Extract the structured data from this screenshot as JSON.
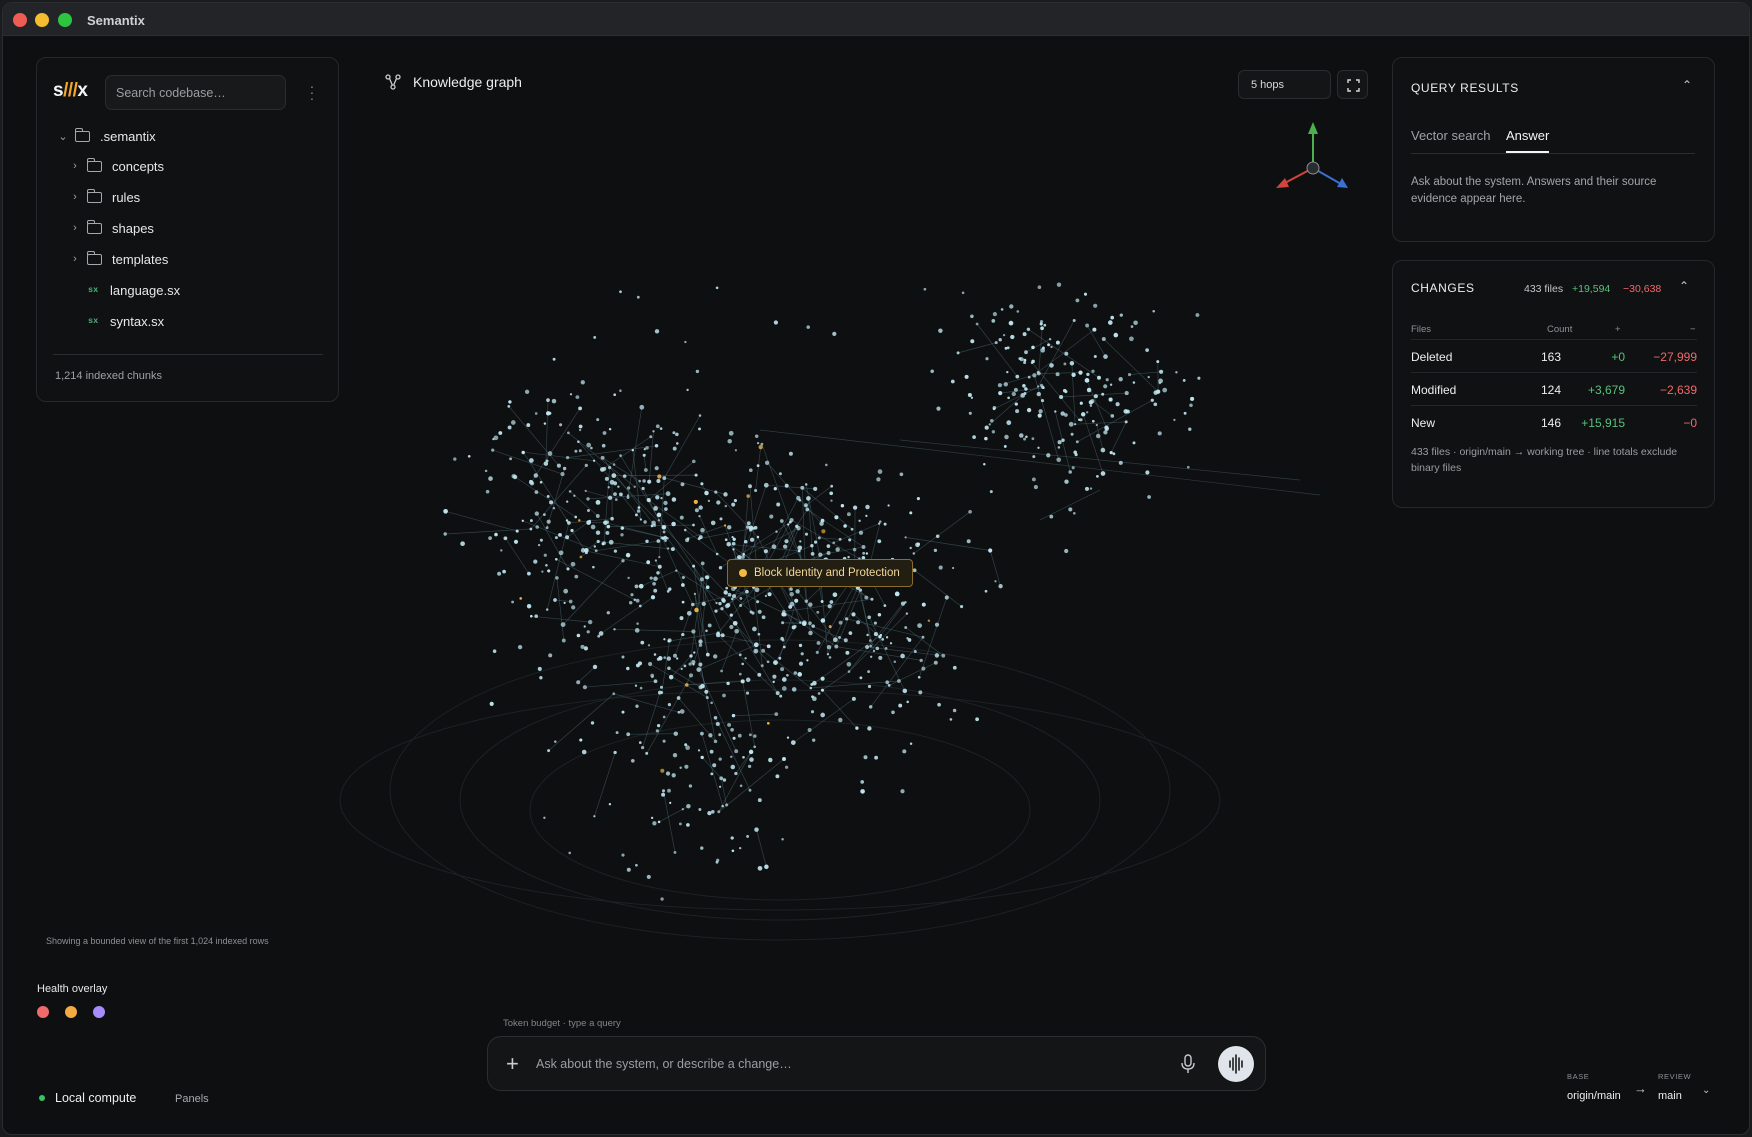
{
  "app": {
    "title": "Semantix"
  },
  "explorer": {
    "logo": {
      "a": "s",
      "b": "///",
      "c": "x"
    },
    "search_placeholder": "Search codebase…",
    "tree": [
      {
        "label": ".semantix",
        "type": "folder",
        "expanded": true,
        "depth": 0
      },
      {
        "label": "concepts",
        "type": "folder",
        "expanded": false,
        "depth": 1
      },
      {
        "label": "rules",
        "type": "folder",
        "expanded": false,
        "depth": 1
      },
      {
        "label": "shapes",
        "type": "folder",
        "expanded": false,
        "depth": 1
      },
      {
        "label": "templates",
        "type": "folder",
        "expanded": false,
        "depth": 1
      },
      {
        "label": "language.sx",
        "type": "file",
        "badge": "sx",
        "depth": 1
      },
      {
        "label": "syntax.sx",
        "type": "file",
        "badge": "sx",
        "depth": 1
      }
    ],
    "indexed_chunks": "1,214 indexed chunks"
  },
  "graph": {
    "title": "Knowledge graph",
    "hops": "5 hops",
    "selected_node": "Block Identity and Protection",
    "bounded_note": "Showing a bounded view of the first 1,024 indexed rows",
    "colors": {
      "node": "#bfe6f0",
      "edge": "#5a7f8c",
      "highlight": "#f4b942"
    }
  },
  "health": {
    "title": "Health overlay",
    "dots": [
      "#ef6a6a",
      "#f4a942",
      "#a78bfa"
    ]
  },
  "footer": {
    "local_compute": "Local compute",
    "panels": "Panels",
    "base_label": "BASE",
    "base_value": "origin/main",
    "review_label": "REVIEW",
    "review_value": "main"
  },
  "prompt": {
    "token_budget": "Token budget · type a query",
    "placeholder": "Ask about the system, or describe a change…"
  },
  "query_results": {
    "title": "QUERY RESULTS",
    "tabs": [
      "Vector search",
      "Answer"
    ],
    "active_tab": "Answer",
    "hint": "Ask about the system. Answers and their source evidence appear here."
  },
  "changes": {
    "title": "CHANGES",
    "files": "433 files",
    "added": "+19,594",
    "removed": "−30,638",
    "headers": [
      "Files",
      "Count",
      "+",
      "−"
    ],
    "rows": [
      {
        "label": "Deleted",
        "count": "163",
        "plus": "+0",
        "minus": "−27,999"
      },
      {
        "label": "Modified",
        "count": "124",
        "plus": "+3,679",
        "minus": "−2,639"
      },
      {
        "label": "New",
        "count": "146",
        "plus": "+15,915",
        "minus": "−0"
      }
    ],
    "note": "433 files · origin/main → working tree · line totals exclude binary files"
  }
}
